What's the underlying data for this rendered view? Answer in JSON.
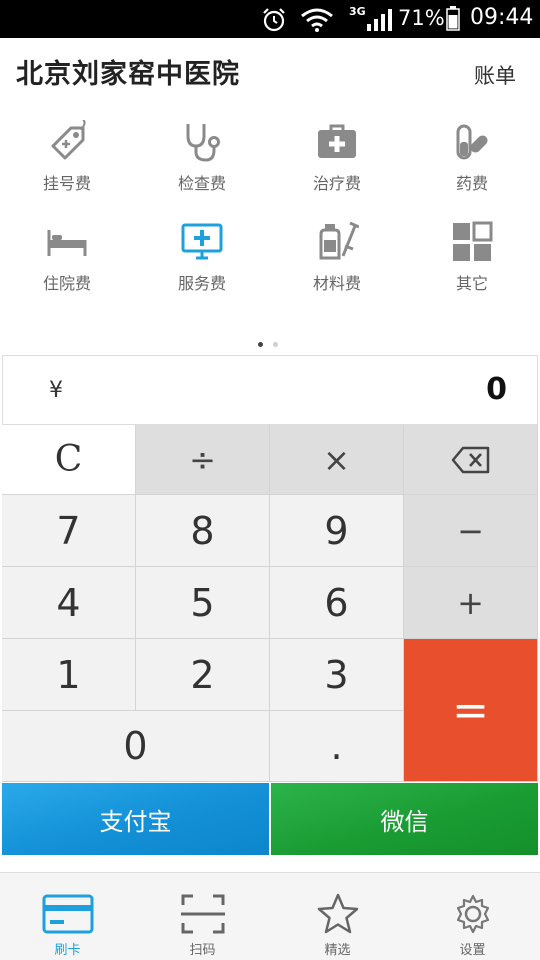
{
  "statusbar": {
    "network": "3G",
    "battery": "71%",
    "time": "09:44"
  },
  "header": {
    "title": "北京刘家窑中医院",
    "bill_label": "账单"
  },
  "categories": [
    {
      "label": "挂号费",
      "icon": "tag-icon"
    },
    {
      "label": "检查费",
      "icon": "stethoscope-icon"
    },
    {
      "label": "治疗费",
      "icon": "medical-kit-icon"
    },
    {
      "label": "药费",
      "icon": "pill-icon"
    },
    {
      "label": "住院费",
      "icon": "bed-icon"
    },
    {
      "label": "服务费",
      "icon": "monitor-cross-icon"
    },
    {
      "label": "材料费",
      "icon": "syringe-bottle-icon"
    },
    {
      "label": "其它",
      "icon": "grid-icon"
    }
  ],
  "pager": {
    "count": 2,
    "active": 0
  },
  "calculator": {
    "currency": "¥",
    "display": "0",
    "keys": {
      "clear": "C",
      "divide": "÷",
      "multiply": "×",
      "seven": "7",
      "eight": "8",
      "nine": "9",
      "minus": "−",
      "four": "4",
      "five": "5",
      "six": "6",
      "plus": "+",
      "one": "1",
      "two": "2",
      "three": "3",
      "equals": "=",
      "zero": "0",
      "dot": "."
    }
  },
  "payment": {
    "alipay": "支付宝",
    "wechat": "微信"
  },
  "tabs": [
    {
      "label": "刷卡",
      "icon": "card-icon",
      "active": true
    },
    {
      "label": "扫码",
      "icon": "scan-icon",
      "active": false
    },
    {
      "label": "精选",
      "icon": "star-icon",
      "active": false
    },
    {
      "label": "设置",
      "icon": "gear-icon",
      "active": false
    }
  ],
  "colors": {
    "accent": "#1ea0dc",
    "equals": "#e84f2c",
    "alipay": "#1390d6",
    "wechat": "#1a9c33",
    "icon_gray": "#8a8a8a"
  }
}
